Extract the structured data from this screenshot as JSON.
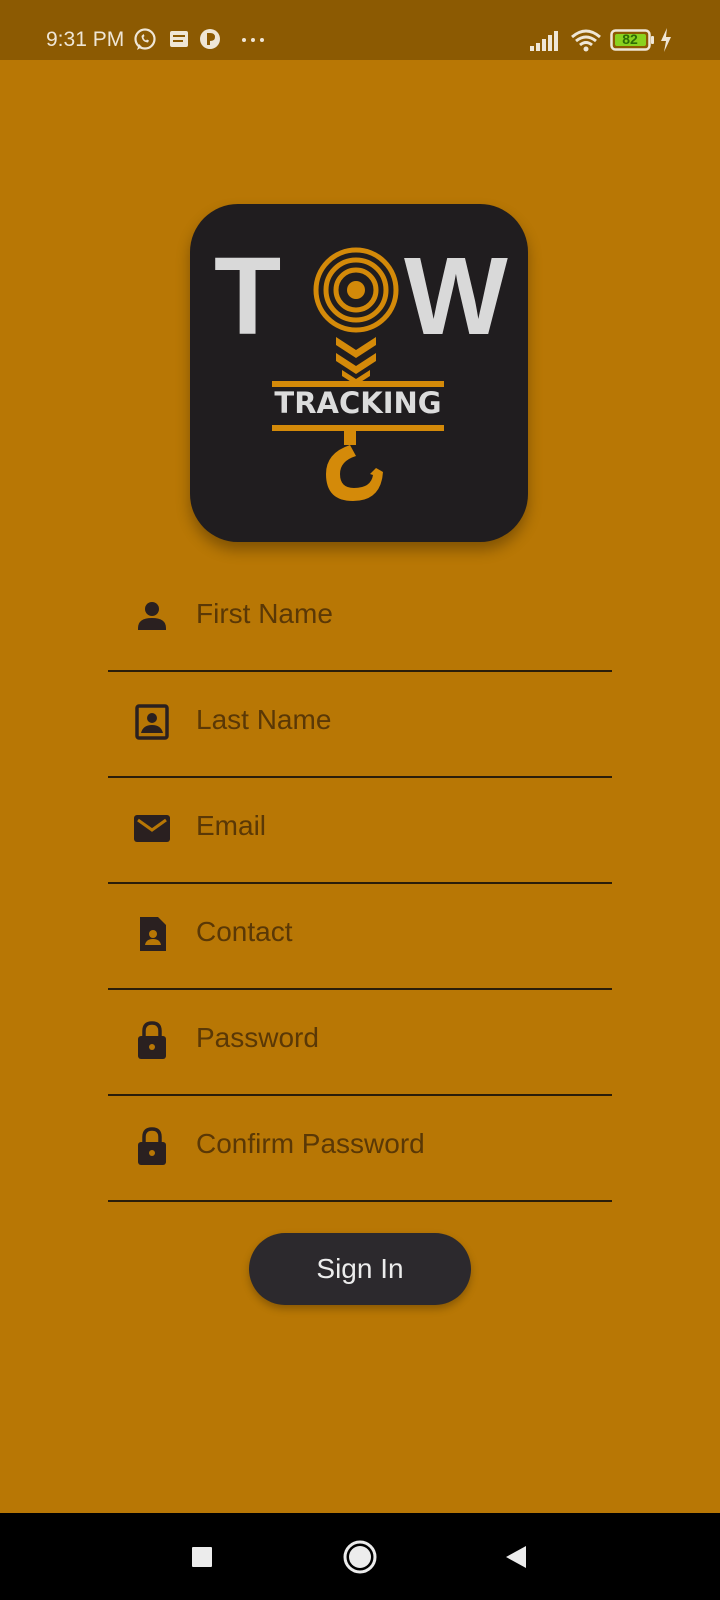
{
  "status_bar": {
    "time": "9:31 PM",
    "notification_icons": [
      "whatsapp-icon",
      "message-icon",
      "app-icon",
      "more-dots-icon"
    ],
    "battery_level": "82",
    "signal_icon": "signal-icon",
    "wifi_icon": "wifi-icon",
    "charging_icon": "charging-bolt-icon"
  },
  "logo": {
    "big_text_left": "T",
    "big_text_right": "W",
    "subtitle": "TRACKING",
    "colors": {
      "card": "#201d1f",
      "letters": "#d9d9d9",
      "accent": "#d48a09"
    }
  },
  "form": {
    "fields": [
      {
        "placeholder": "First Name",
        "icon": "person-icon",
        "value": ""
      },
      {
        "placeholder": "Last Name",
        "icon": "contact-box-icon",
        "value": ""
      },
      {
        "placeholder": "Email",
        "icon": "mail-icon",
        "value": ""
      },
      {
        "placeholder": "Contact",
        "icon": "contact-card-icon",
        "value": ""
      },
      {
        "placeholder": "Password",
        "icon": "lock-icon",
        "value": ""
      },
      {
        "placeholder": "Confirm Password",
        "icon": "lock-icon",
        "value": ""
      }
    ],
    "submit_label": "Sign In"
  },
  "nav_bar": {
    "buttons": [
      "recents-square-icon",
      "home-circle-icon",
      "back-triangle-icon"
    ]
  },
  "colors": {
    "background": "#b87705",
    "status_bar": "#8c5a02",
    "button": "#2c292d",
    "nav_bar": "#000000"
  }
}
